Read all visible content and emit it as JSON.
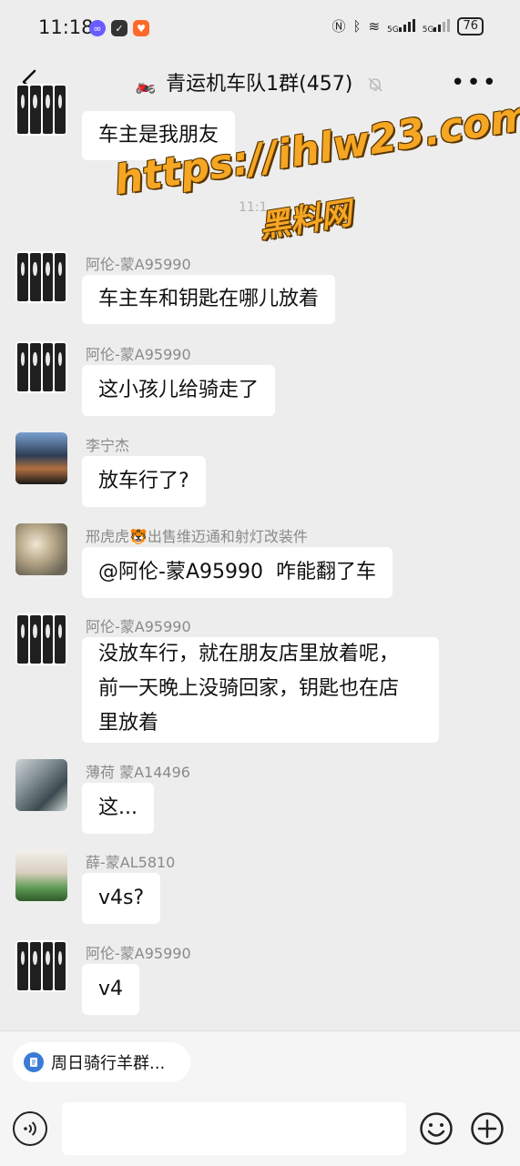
{
  "status_bar": {
    "time": "11:18",
    "network_a": "5G",
    "network_b": "5G",
    "battery": "76"
  },
  "header": {
    "title": "青运机车队1群(457)",
    "title_emoji": "🏍️"
  },
  "watermark": {
    "line1": "https://ihlw23.com",
    "line2": "黑料网"
  },
  "faded_time": "11:1",
  "messages": [
    {
      "sender": "",
      "text": "车主是我朋友"
    },
    {
      "sender": "阿伦-蒙A95990",
      "text": "车主车和钥匙在哪儿放着"
    },
    {
      "sender": "阿伦-蒙A95990",
      "text": "这小孩儿给骑走了"
    },
    {
      "sender": "李宁杰",
      "text": "放车行了?"
    },
    {
      "sender": "邢虎虎🐯出售维迈通和射灯改装件",
      "text": "@阿伦-蒙A95990  咋能翻了车"
    },
    {
      "sender": "阿伦-蒙A95990",
      "text": "没放车行，就在朋友店里放着呢，\n前一天晚上没骑回家，钥匙也在店\n里放着"
    },
    {
      "sender": "薄荷 蒙A14496",
      "text": "这..."
    },
    {
      "sender": "薛-蒙AL5810",
      "text": "v4s?"
    },
    {
      "sender": "阿伦-蒙A95990",
      "text": "v4"
    }
  ],
  "bottom": {
    "quick_chip": "周日骑行羊群...",
    "input_placeholder": ""
  }
}
